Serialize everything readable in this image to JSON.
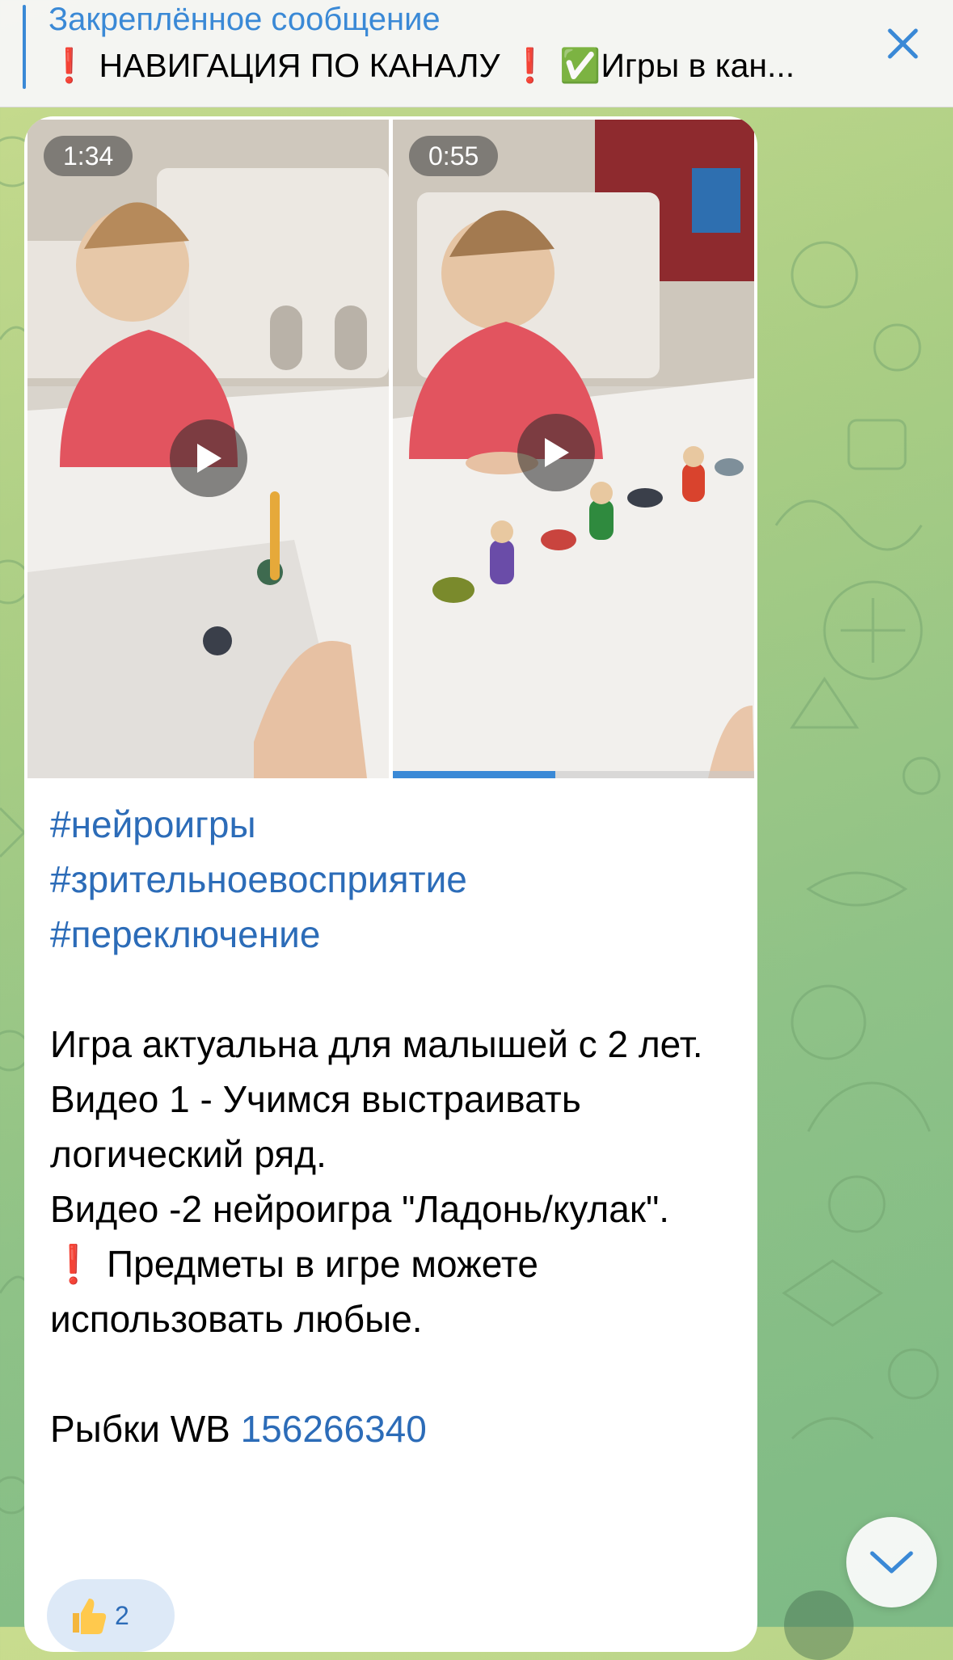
{
  "pinned": {
    "title": "Закреплённое сообщение",
    "text": "❗️ НАВИГАЦИЯ ПО КАНАЛУ ❗️ ✅Игры в кан..."
  },
  "videos": [
    {
      "duration": "1:34"
    },
    {
      "duration": "0:55",
      "progress": 0.45
    }
  ],
  "message": {
    "hashtags": [
      "#нейроигры",
      "#зрительноевосприятие",
      "#переключение"
    ],
    "paragraphs": [
      "Игра актуальна для малышей с 2 лет.",
      "Видео 1 - Учимся выстраивать логический ряд.",
      "Видео -2 нейроигра \"Ладонь/кулак\".",
      "❗️ Предметы в игре можете использовать любые."
    ],
    "product_label": "Рыбки WB ",
    "product_link": "156266340"
  },
  "reaction": {
    "emoji": "thumbs-up-icon",
    "count": "2"
  },
  "colors": {
    "accent": "#3a89d6",
    "link": "#2c6cb8"
  }
}
